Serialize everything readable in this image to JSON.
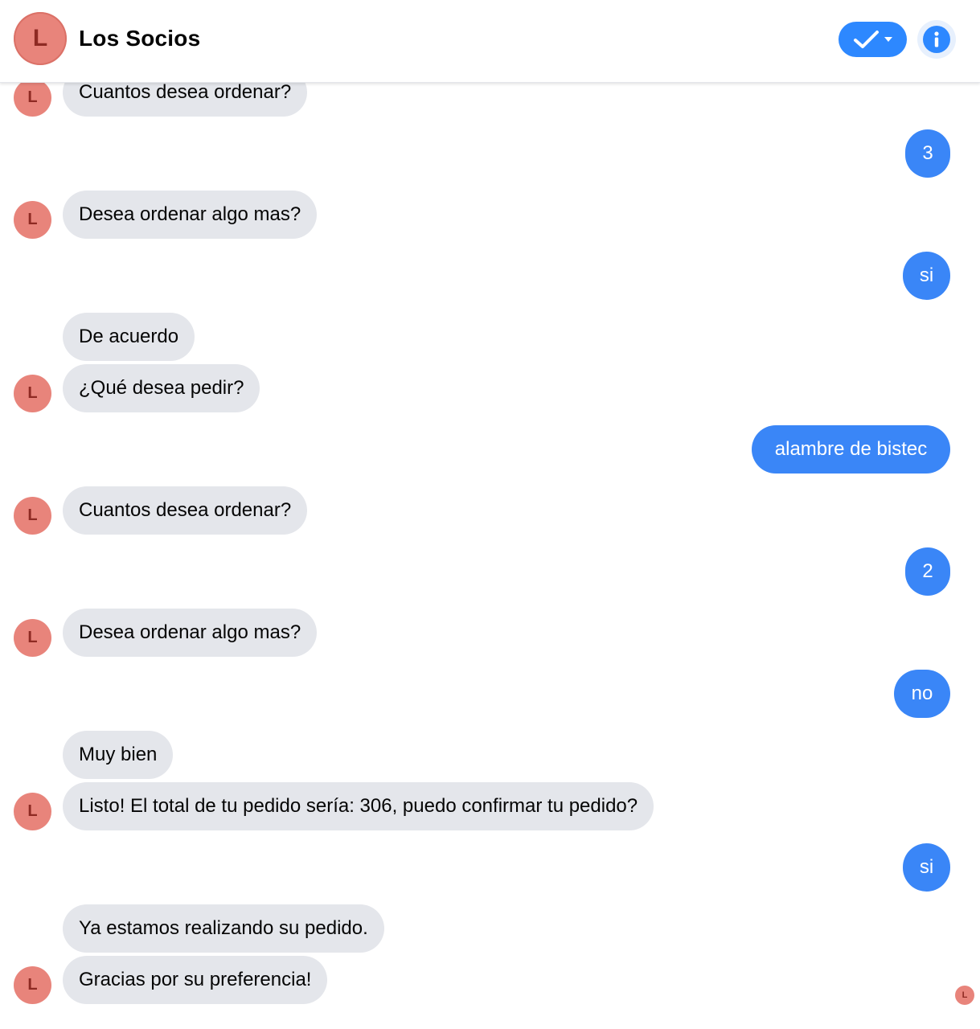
{
  "header": {
    "title": "Los Socios",
    "avatar_letter": "L",
    "check_icon": "check-dropdown-icon",
    "info_icon": "info-icon",
    "accent": "#2d88ff",
    "avatar_color": "#e8847b"
  },
  "messages": [
    {
      "from": "bot",
      "text": "Cuantos desea ordenar?",
      "avatar": "L"
    },
    {
      "from": "user",
      "text": "3"
    },
    {
      "from": "bot",
      "text": "Desea ordenar algo mas?",
      "avatar": "L"
    },
    {
      "from": "user",
      "text": "si"
    },
    {
      "from": "bot",
      "text": "De acuerdo"
    },
    {
      "from": "bot",
      "text": "¿Qué desea pedir?",
      "avatar": "L"
    },
    {
      "from": "user",
      "text": "alambre de bistec"
    },
    {
      "from": "bot",
      "text": "Cuantos desea ordenar?",
      "avatar": "L"
    },
    {
      "from": "user",
      "text": "2"
    },
    {
      "from": "bot",
      "text": "Desea ordenar algo mas?",
      "avatar": "L"
    },
    {
      "from": "user",
      "text": "no"
    },
    {
      "from": "bot",
      "text": "Muy bien"
    },
    {
      "from": "bot",
      "text": "Listo! El total de tu pedido sería: 306, puedo confirmar tu pedido?",
      "avatar": "L"
    },
    {
      "from": "user",
      "text": "si"
    },
    {
      "from": "bot",
      "text": "Ya estamos realizando su pedido."
    },
    {
      "from": "bot",
      "text": "Gracias por su preferencia!",
      "avatar": "L"
    }
  ],
  "seen_indicator": "L"
}
